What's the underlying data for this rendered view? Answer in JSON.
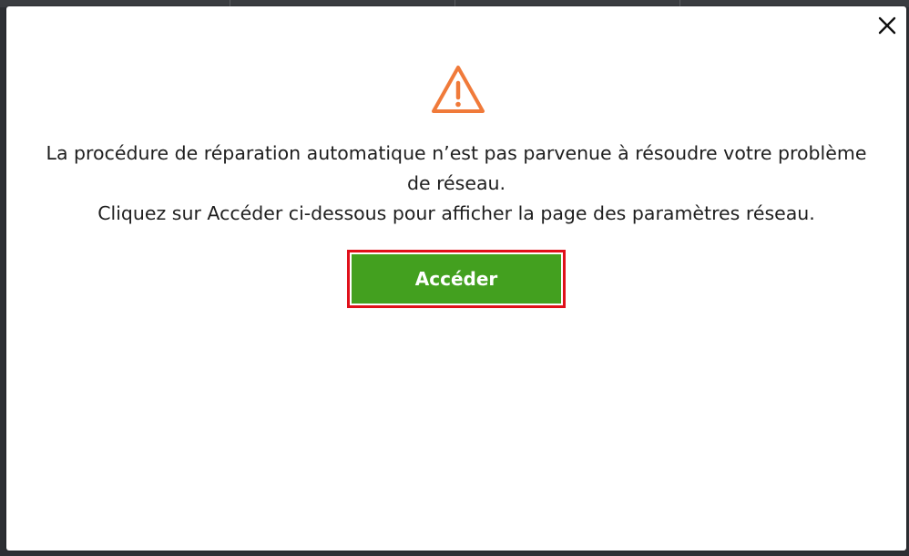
{
  "dialog": {
    "close_icon": "close-icon",
    "warning_icon": "warning-triangle-icon",
    "message_lines": [
      "La procédure de réparation automatique n’est pas parvenue à résoudre votre problème",
      "de réseau.",
      "Cliquez sur Accéder ci-dessous pour afficher la page des paramètres réseau."
    ],
    "primary_button_label": "Accéder"
  },
  "colors": {
    "accent_green": "#43a01f",
    "warning_orange": "#f07a3a",
    "highlight_red": "#e0101a"
  }
}
